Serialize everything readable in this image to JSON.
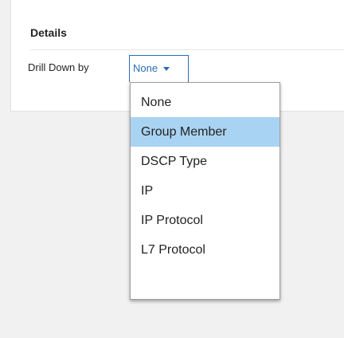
{
  "details_panel": {
    "title": "Details",
    "drill_down_label": "Drill Down by",
    "selected_value": "None"
  },
  "dropdown": {
    "highlighted_option": "Group Member",
    "options": [
      {
        "label": "None"
      },
      {
        "label": "Group Member"
      },
      {
        "label": "DSCP Type"
      },
      {
        "label": "IP"
      },
      {
        "label": "IP Protocol"
      },
      {
        "label": "L7 Protocol"
      }
    ]
  },
  "colors": {
    "accent": "#2a6db5",
    "highlight": "#a9d3f2",
    "background": "#f1f1f1"
  }
}
